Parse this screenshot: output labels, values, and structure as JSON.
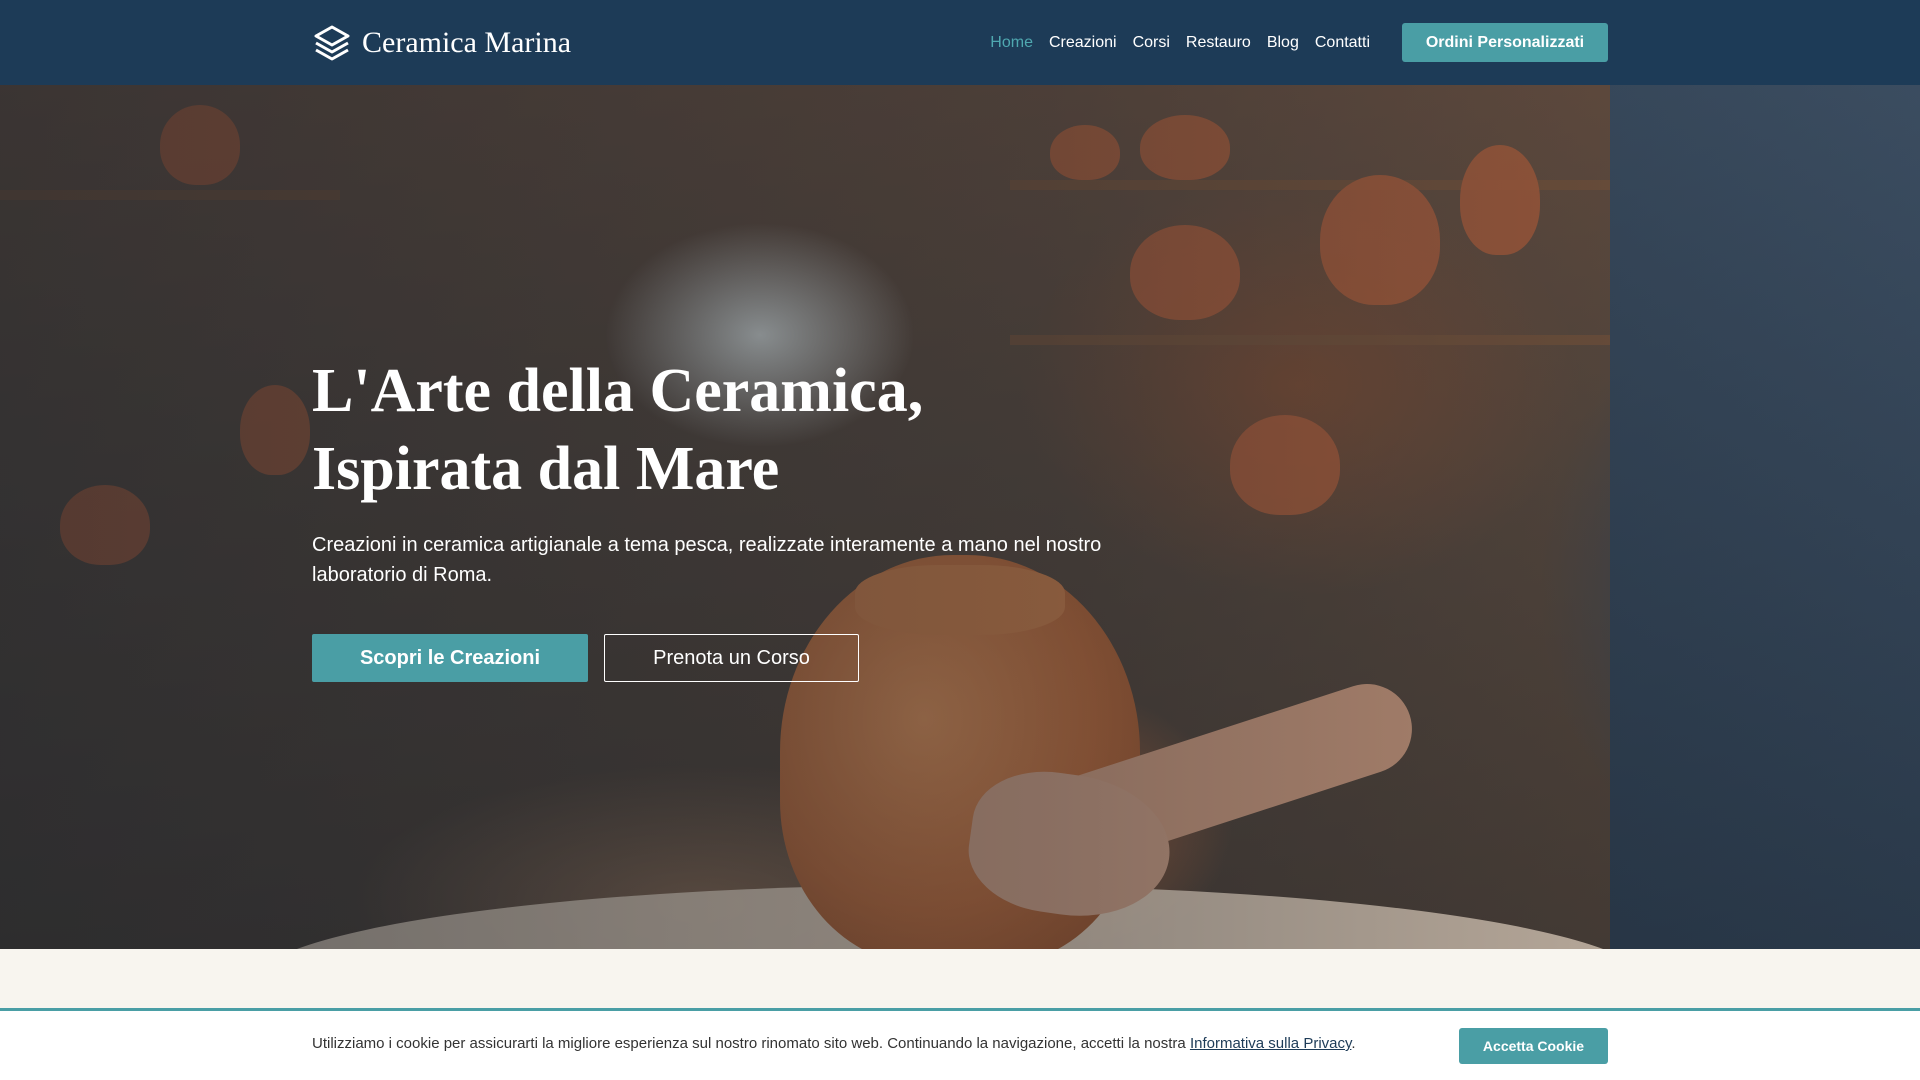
{
  "header": {
    "brand_name": "Ceramica Marina",
    "logo_icon": "layers-icon",
    "nav": [
      {
        "label": "Home",
        "active": true
      },
      {
        "label": "Creazioni"
      },
      {
        "label": "Corsi"
      },
      {
        "label": "Restauro"
      },
      {
        "label": "Blog"
      },
      {
        "label": "Contatti"
      }
    ],
    "cta_label": "Ordini Personalizzati"
  },
  "hero": {
    "title_line1": "L'Arte della Ceramica,",
    "title_line2": "Ispirata dal Mare",
    "subtitle": "Creazioni in ceramica artigianale a tema pesca, realizzate interamente a mano nel nostro laboratorio di Roma.",
    "primary_button": "Scopri le Creazioni",
    "secondary_button": "Prenota un Corso"
  },
  "cookie": {
    "text": "Utilizziamo i cookie per assicurarti la migliore esperienza sul nostro rinomato sito web. Continuando la navigazione, accetti la nostra",
    "link_label": "Informativa sulla Privacy",
    "suffix": ".",
    "button": "Accetta Cookie"
  },
  "colors": {
    "header_bg": "#1d3b57",
    "accent": "#4a9ea5",
    "active_nav": "#4fa8b0",
    "page_bg": "#f8f5ef"
  }
}
